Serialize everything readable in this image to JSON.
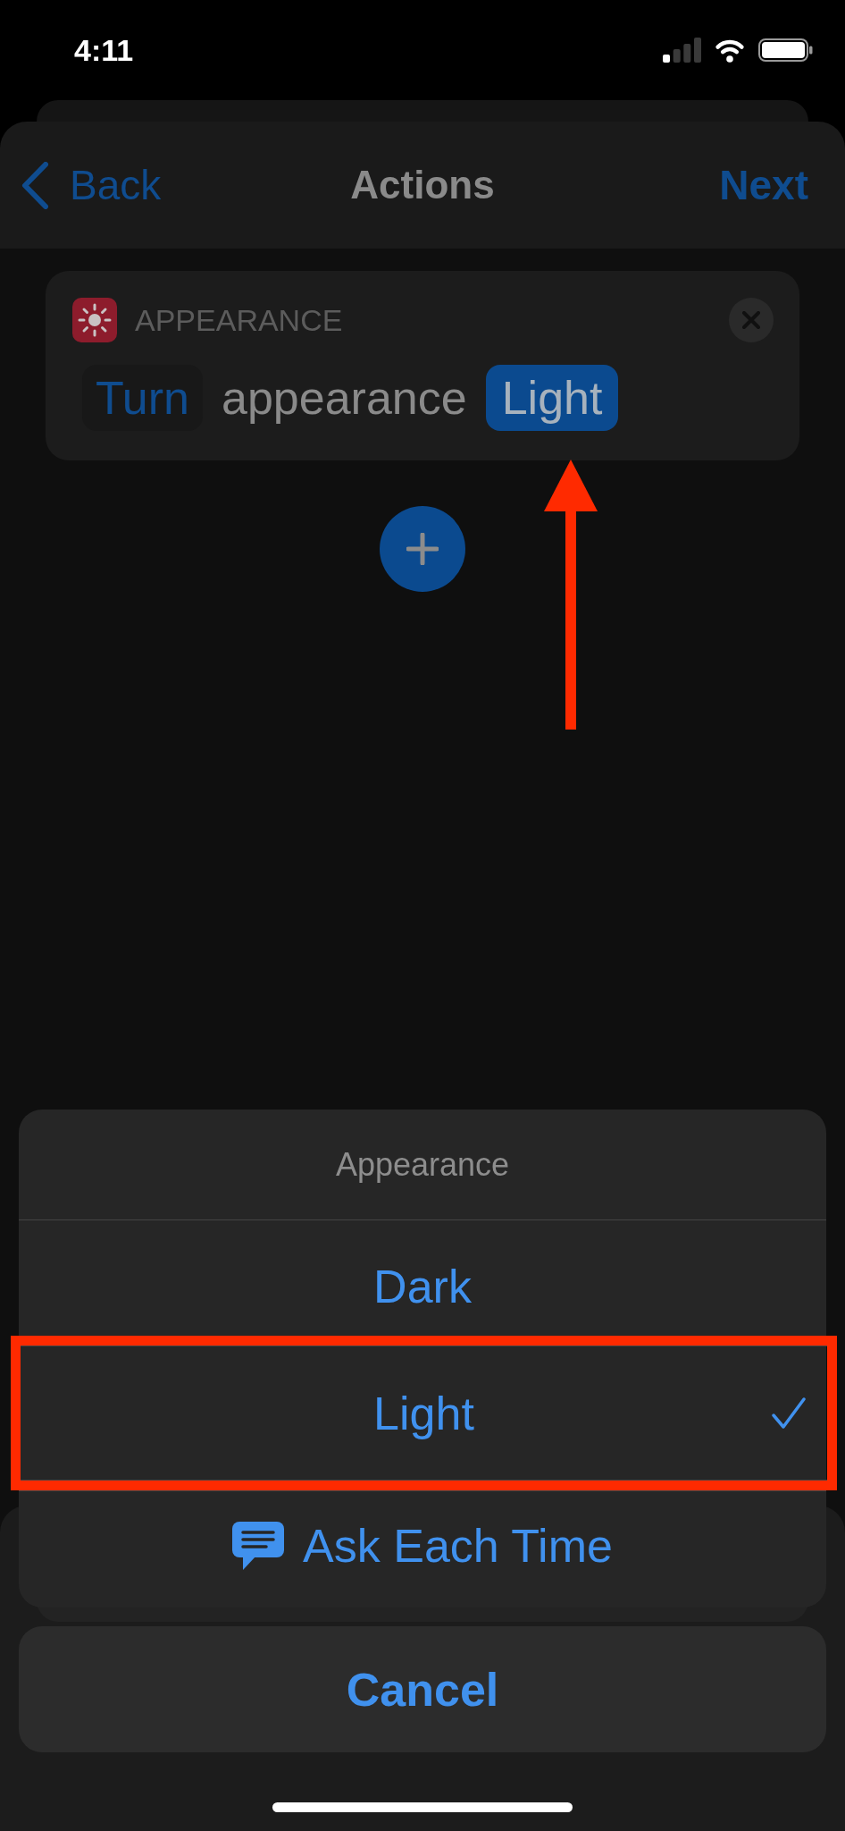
{
  "status_bar": {
    "time": "4:11"
  },
  "nav_bar": {
    "back": "Back",
    "title": "Actions",
    "next": "Next"
  },
  "action_card": {
    "app_label": "APPEARANCE",
    "tokens": [
      {
        "text": "Turn",
        "kind": "parameter"
      },
      {
        "text": "appearance",
        "kind": "text"
      },
      {
        "text": "Light",
        "kind": "variable"
      }
    ]
  },
  "annotations": [
    {
      "kind": "arrow"
    }
  ],
  "action_sheet": {
    "title": "Appearance",
    "options": [
      {
        "label": "Dark",
        "kind": "value",
        "selected": false,
        "highlighted": false
      },
      {
        "label": "Light",
        "kind": "value",
        "selected": true,
        "highlighted": true
      },
      {
        "label": "Ask Each Time",
        "kind": "prompt",
        "selected": false,
        "highlighted": false
      }
    ],
    "cancel": "Cancel"
  }
}
